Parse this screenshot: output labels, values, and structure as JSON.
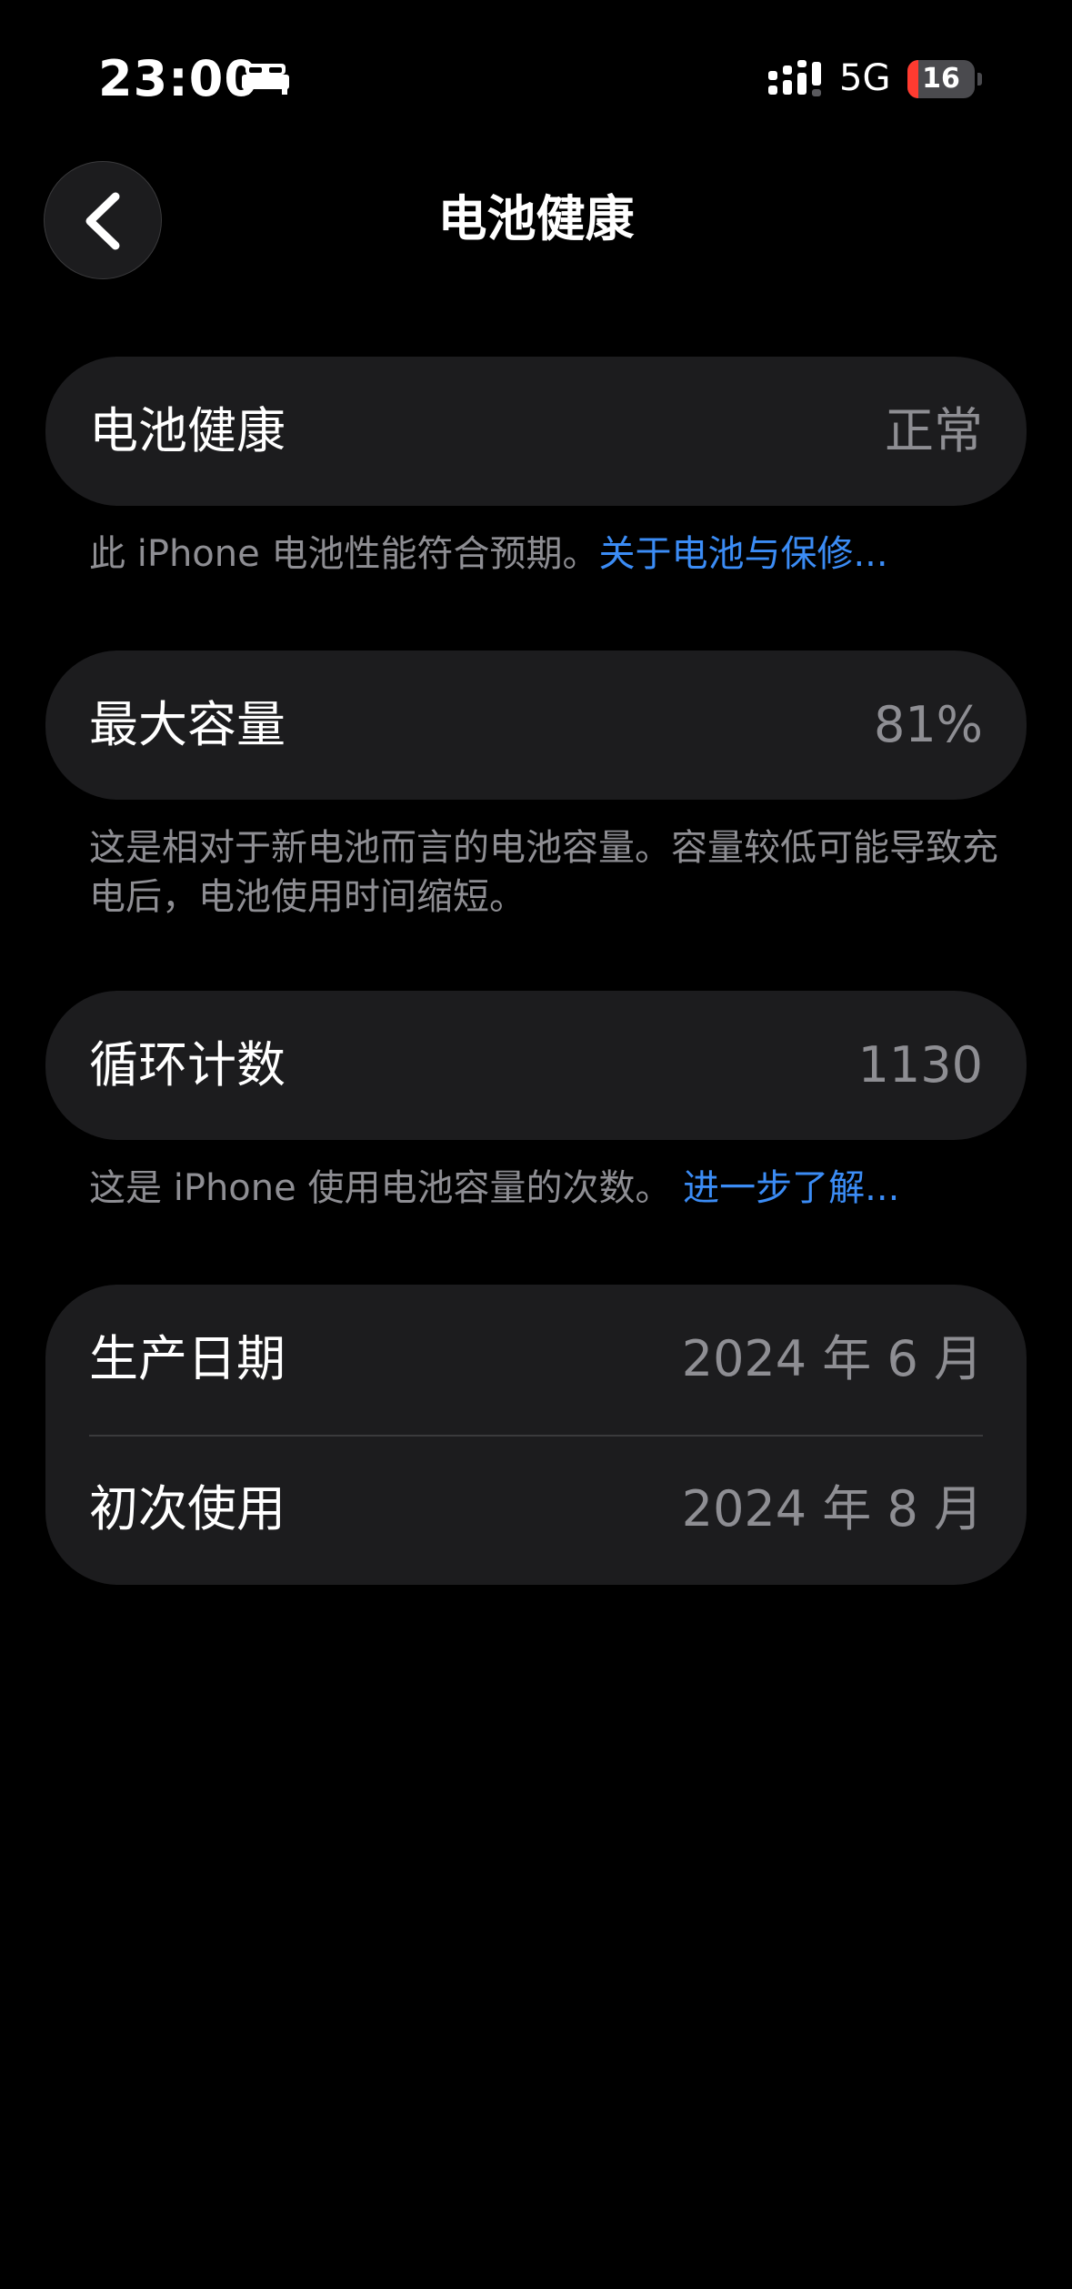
{
  "status_bar": {
    "time": "23:00",
    "sleep_icon": "bed-icon",
    "signal_icon": "cellular-signal-icon",
    "network": "5G",
    "battery_level": "16",
    "battery_fraction": 0.16,
    "battery_color": "#ff3b30"
  },
  "nav": {
    "back_icon": "chevron-left-icon",
    "title": "电池健康"
  },
  "battery_health": {
    "label": "电池健康",
    "value": "正常",
    "footnote": "此 iPhone 电池性能符合预期。",
    "footnote_link": "关于电池与保修..."
  },
  "max_capacity": {
    "label": "最大容量",
    "value": "81%",
    "footnote": "这是相对于新电池而言的电池容量。容量较低可能导致充电后，电池使用时间缩短。"
  },
  "cycle_count": {
    "label": "循环计数",
    "value": "1130",
    "footnote": "这是 iPhone 使用电池容量的次数。",
    "footnote_link": "进一步了解..."
  },
  "dates": {
    "manufacture_label": "生产日期",
    "manufacture_value": "2024 年 6 月",
    "first_use_label": "初次使用",
    "first_use_value": "2024 年 8 月"
  },
  "colors": {
    "background": "#000000",
    "card": "#1c1c1e",
    "secondary_text": "#8e8e93",
    "link": "#3b8cf5"
  }
}
